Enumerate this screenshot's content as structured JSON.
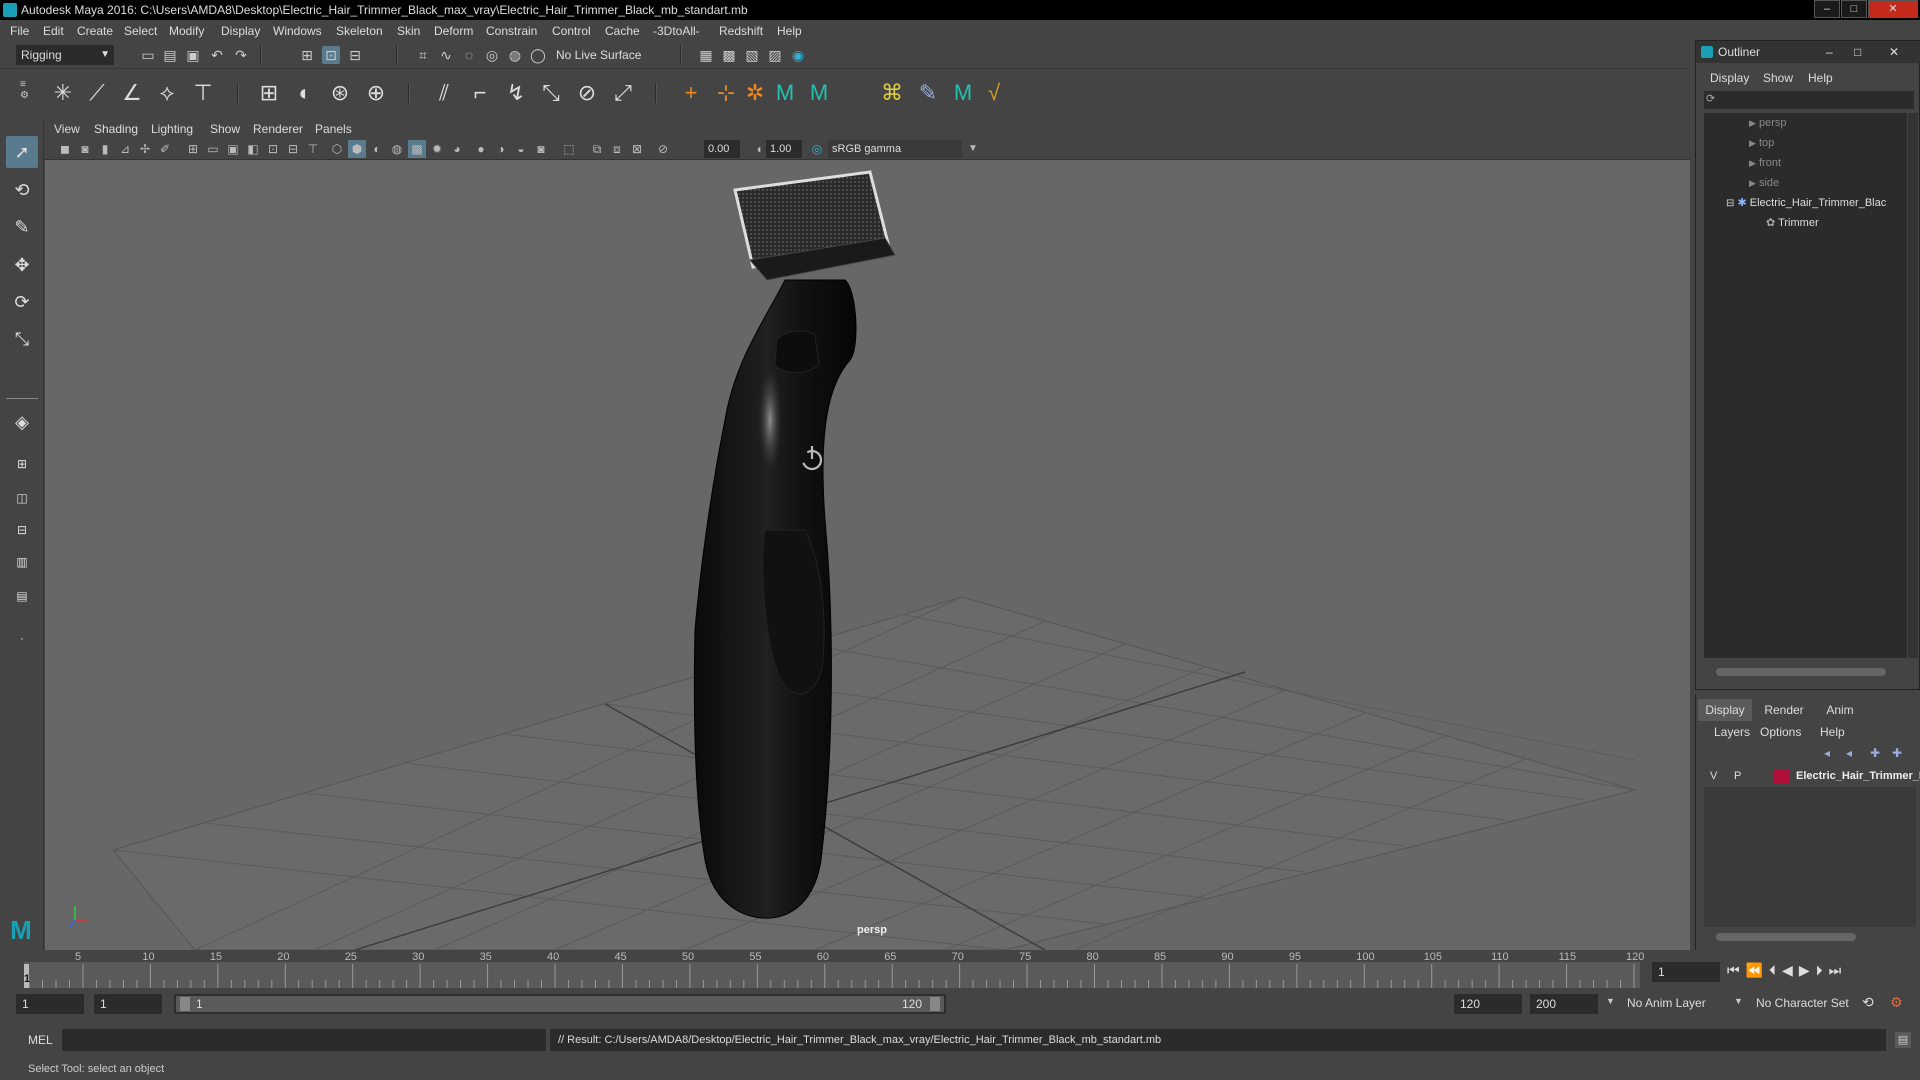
{
  "window": {
    "title": "Autodesk Maya 2016: C:\\Users\\AMDA8\\Desktop\\Electric_Hair_Trimmer_Black_max_vray\\Electric_Hair_Trimmer_Black_mb_standart.mb"
  },
  "menubar": {
    "items": [
      "File",
      "Edit",
      "Create",
      "Select",
      "Modify",
      "Display",
      "Windows",
      "Skeleton",
      "Skin",
      "Deform",
      "Constrain",
      "Control",
      "Cache",
      "-3DtoAll-",
      "Redshift",
      "Help"
    ]
  },
  "statusline": {
    "mode": "Rigging",
    "live_surface": "No Live Surface"
  },
  "panel": {
    "menu": [
      "View",
      "Shading",
      "Lighting",
      "Show",
      "Renderer",
      "Panels"
    ],
    "exposure": "0.00",
    "gamma": "1.00",
    "colorspace": "sRGB gamma",
    "camera_label": "persp"
  },
  "outliner": {
    "title": "Outliner",
    "menu": [
      "Display",
      "Show",
      "Help"
    ],
    "items": [
      "persp",
      "top",
      "front",
      "side",
      "Electric_Hair_Trimmer_Blac",
      "Trimmer"
    ]
  },
  "layers": {
    "tabs": [
      "Display",
      "Render",
      "Anim"
    ],
    "menu": [
      "Layers",
      "Options",
      "Help"
    ],
    "row": {
      "v": "V",
      "p": "P",
      "name": "Electric_Hair_Trimmer_E",
      "color": "#b0103a"
    }
  },
  "timeline": {
    "ticks": [
      "5",
      "10",
      "15",
      "20",
      "25",
      "30",
      "35",
      "40",
      "45",
      "50",
      "55",
      "60",
      "65",
      "70",
      "75",
      "80",
      "85",
      "90",
      "95",
      "100",
      "105",
      "110",
      "115",
      "120"
    ],
    "start_tick": "1",
    "current_frame": "1"
  },
  "range": {
    "start": "1",
    "playback_start": "1",
    "slider_start": "1",
    "slider_end": "120",
    "playback_end": "120",
    "end": "200",
    "anim_layer": "No Anim Layer",
    "character_set": "No Character Set"
  },
  "cmdline": {
    "lang": "MEL",
    "result": "// Result: C:/Users/AMDA8/Desktop/Electric_Hair_Trimmer_Black_max_vray/Electric_Hair_Trimmer_Black_mb_standart.mb"
  },
  "helpline": {
    "text": "Select Tool: select an object"
  },
  "colors": {
    "accent": "#1aa0b4",
    "layer": "#b0103a",
    "viewport": "#676767"
  }
}
